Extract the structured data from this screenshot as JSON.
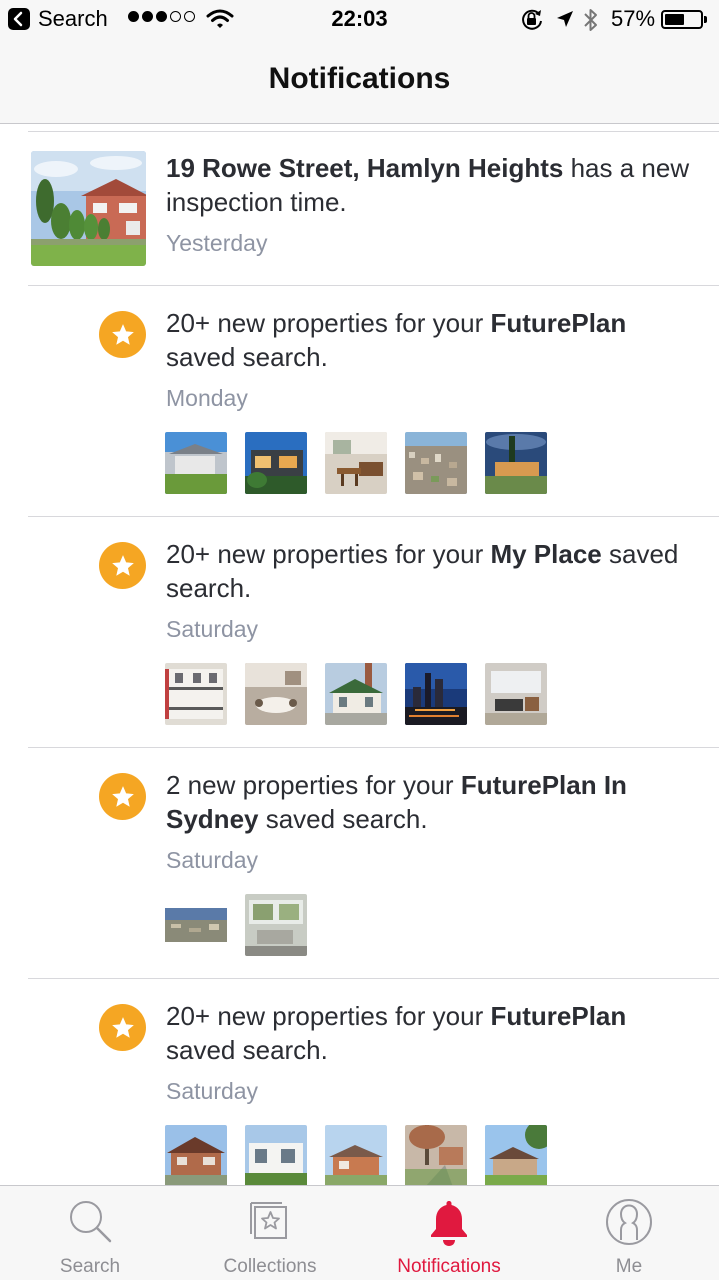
{
  "status_bar": {
    "back_label": "Search",
    "time": "22:03",
    "battery_percent": "57%",
    "battery_level": 0.57,
    "signal_bars": 3,
    "signal_total": 5
  },
  "nav": {
    "title": "Notifications"
  },
  "colors": {
    "accent": "#e0193f",
    "star_badge": "#f5a623",
    "secondary_text": "#8e94a3",
    "body_text": "#2b2d33"
  },
  "notifications": [
    {
      "bold_lead": "19 Rowe Street, Hamlyn Heights",
      "text_after": " has a new inspection time.",
      "time": "Yesterday",
      "icon": "house-photo"
    },
    {
      "text_before": "20+ new properties for your ",
      "bold": "FuturePlan",
      "text_after": " saved search.",
      "time": "Monday",
      "icon": "star-icon",
      "thumbnails": [
        "house-photo",
        "modern-house-photo",
        "dining-room-photo",
        "aerial-city-photo",
        "lake-house-photo"
      ]
    },
    {
      "text_before": "20+ new properties for your ",
      "bold": "My Place",
      "text_after": " saved search.",
      "time": "Saturday",
      "icon": "star-icon",
      "thumbnails": [
        "terrace-house-photo",
        "kitchen-photo",
        "cottage-photo",
        "city-night-photo",
        "living-room-photo"
      ]
    },
    {
      "text_before": "2 new properties for your ",
      "bold": "FuturePlan In Sydney",
      "text_after": " saved search.",
      "time": "Saturday",
      "icon": "star-icon",
      "thumbnails": [
        "aerial-suburb-photo",
        "interior-photo"
      ]
    },
    {
      "text_before": "20+ new properties for your ",
      "bold": "FuturePlan",
      "text_after": " saved search.",
      "time": "Saturday",
      "icon": "star-icon",
      "thumbnails": [
        "brick-house-photo",
        "white-house-photo",
        "bungalow-photo",
        "tree-street-photo",
        "garden-house-photo"
      ]
    }
  ],
  "tabs": [
    {
      "label": "Search",
      "icon": "search-icon",
      "active": false
    },
    {
      "label": "Collections",
      "icon": "collections-icon",
      "active": false
    },
    {
      "label": "Notifications",
      "icon": "bell-icon",
      "active": true
    },
    {
      "label": "Me",
      "icon": "profile-icon",
      "active": false
    }
  ]
}
